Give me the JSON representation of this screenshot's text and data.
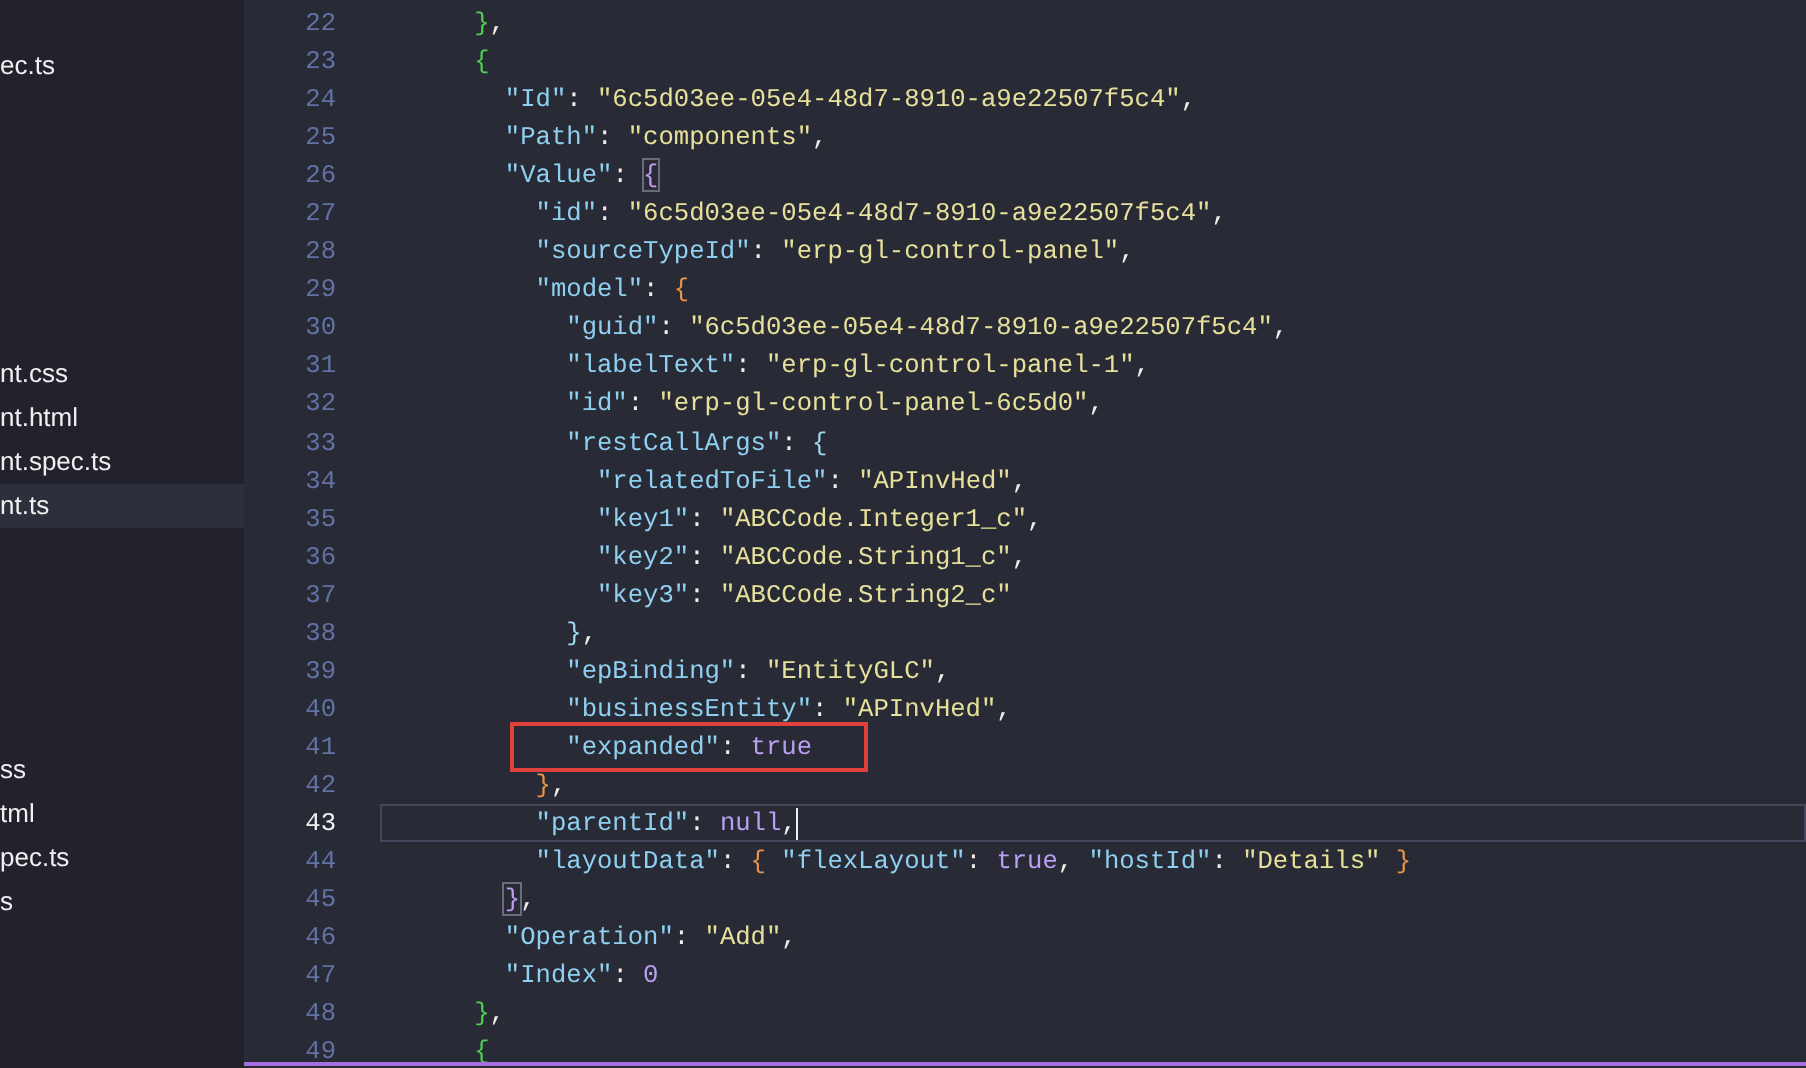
{
  "sidebar": {
    "items": [
      {
        "label": "ec.ts",
        "selected": false
      },
      {
        "label": "nt.css",
        "selected": false
      },
      {
        "label": "nt.html",
        "selected": false
      },
      {
        "label": "nt.spec.ts",
        "selected": false
      },
      {
        "label": "nt.ts",
        "selected": true
      },
      {
        "label": "ss",
        "selected": false
      },
      {
        "label": "tml",
        "selected": false
      },
      {
        "label": "pec.ts",
        "selected": false
      },
      {
        "label": "s",
        "selected": false
      }
    ]
  },
  "editor": {
    "lines": [
      {
        "number": "22",
        "current": false,
        "highlighted": false,
        "tokens": [
          {
            "kind": "brace",
            "text": "}",
            "color": "#50d050",
            "matched": false
          },
          {
            "kind": "punct",
            "text": ","
          }
        ]
      },
      {
        "number": "23",
        "current": false,
        "highlighted": false,
        "tokens": [
          {
            "kind": "brace",
            "text": "{",
            "color": "#50d050",
            "matched": false
          }
        ]
      },
      {
        "number": "24",
        "current": false,
        "highlighted": false,
        "tokens": [
          {
            "kind": "key",
            "text": "\"Id\""
          },
          {
            "kind": "punct",
            "text": ": "
          },
          {
            "kind": "str",
            "text": "\"6c5d03ee-05e4-48d7-8910-a9e22507f5c4\""
          },
          {
            "kind": "punct",
            "text": ","
          }
        ]
      },
      {
        "number": "25",
        "current": false,
        "highlighted": false,
        "tokens": [
          {
            "kind": "key",
            "text": "\"Path\""
          },
          {
            "kind": "punct",
            "text": ": "
          },
          {
            "kind": "str",
            "text": "\"components\""
          },
          {
            "kind": "punct",
            "text": ","
          }
        ]
      },
      {
        "number": "26",
        "current": false,
        "highlighted": false,
        "tokens": [
          {
            "kind": "key",
            "text": "\"Value\""
          },
          {
            "kind": "punct",
            "text": ": "
          },
          {
            "kind": "brace",
            "text": "{",
            "color": "#c39bef",
            "matched": true
          }
        ]
      },
      {
        "number": "27",
        "current": false,
        "highlighted": false,
        "tokens": [
          {
            "kind": "key",
            "text": "\"id\""
          },
          {
            "kind": "punct",
            "text": ": "
          },
          {
            "kind": "str",
            "text": "\"6c5d03ee-05e4-48d7-8910-a9e22507f5c4\""
          },
          {
            "kind": "punct",
            "text": ","
          }
        ]
      },
      {
        "number": "28",
        "current": false,
        "highlighted": false,
        "tokens": [
          {
            "kind": "key",
            "text": "\"sourceTypeId\""
          },
          {
            "kind": "punct",
            "text": ": "
          },
          {
            "kind": "str",
            "text": "\"erp-gl-control-panel\""
          },
          {
            "kind": "punct",
            "text": ","
          }
        ]
      },
      {
        "number": "29",
        "current": false,
        "highlighted": false,
        "tokens": [
          {
            "kind": "key",
            "text": "\"model\""
          },
          {
            "kind": "punct",
            "text": ": "
          },
          {
            "kind": "brace",
            "text": "{",
            "color": "#e8944a",
            "matched": false
          }
        ]
      },
      {
        "number": "30",
        "current": false,
        "highlighted": false,
        "tokens": [
          {
            "kind": "key",
            "text": "\"guid\""
          },
          {
            "kind": "punct",
            "text": ": "
          },
          {
            "kind": "str",
            "text": "\"6c5d03ee-05e4-48d7-8910-a9e22507f5c4\""
          },
          {
            "kind": "punct",
            "text": ","
          }
        ]
      },
      {
        "number": "31",
        "current": false,
        "highlighted": false,
        "tokens": [
          {
            "kind": "key",
            "text": "\"labelText\""
          },
          {
            "kind": "punct",
            "text": ": "
          },
          {
            "kind": "str",
            "text": "\"erp-gl-control-panel-1\""
          },
          {
            "kind": "punct",
            "text": ","
          }
        ]
      },
      {
        "number": "32",
        "current": false,
        "highlighted": false,
        "tokens": [
          {
            "kind": "key",
            "text": "\"id\""
          },
          {
            "kind": "punct",
            "text": ": "
          },
          {
            "kind": "str",
            "text": "\"erp-gl-control-panel-6c5d0\""
          },
          {
            "kind": "punct",
            "text": ","
          }
        ]
      },
      {
        "number": "33",
        "current": false,
        "highlighted": false,
        "tokens": [
          {
            "kind": "key",
            "text": "\"restCallArgs\""
          },
          {
            "kind": "punct",
            "text": ": "
          },
          {
            "kind": "brace",
            "text": "{",
            "color": "#9fd8f0",
            "matched": false
          }
        ]
      },
      {
        "number": "34",
        "current": false,
        "highlighted": false,
        "tokens": [
          {
            "kind": "key",
            "text": "\"relatedToFile\""
          },
          {
            "kind": "punct",
            "text": ": "
          },
          {
            "kind": "str",
            "text": "\"APInvHed\""
          },
          {
            "kind": "punct",
            "text": ","
          }
        ]
      },
      {
        "number": "35",
        "current": false,
        "highlighted": false,
        "tokens": [
          {
            "kind": "key",
            "text": "\"key1\""
          },
          {
            "kind": "punct",
            "text": ": "
          },
          {
            "kind": "str",
            "text": "\"ABCCode.Integer1_c\""
          },
          {
            "kind": "punct",
            "text": ","
          }
        ]
      },
      {
        "number": "36",
        "current": false,
        "highlighted": false,
        "tokens": [
          {
            "kind": "key",
            "text": "\"key2\""
          },
          {
            "kind": "punct",
            "text": ": "
          },
          {
            "kind": "str",
            "text": "\"ABCCode.String1_c\""
          },
          {
            "kind": "punct",
            "text": ","
          }
        ]
      },
      {
        "number": "37",
        "current": false,
        "highlighted": false,
        "tokens": [
          {
            "kind": "key",
            "text": "\"key3\""
          },
          {
            "kind": "punct",
            "text": ": "
          },
          {
            "kind": "str",
            "text": "\"ABCCode.String2_c\""
          }
        ]
      },
      {
        "number": "38",
        "current": false,
        "highlighted": false,
        "tokens": [
          {
            "kind": "brace",
            "text": "}",
            "color": "#9fd8f0",
            "matched": false
          },
          {
            "kind": "punct",
            "text": ","
          }
        ]
      },
      {
        "number": "39",
        "current": false,
        "highlighted": false,
        "tokens": [
          {
            "kind": "key",
            "text": "\"epBinding\""
          },
          {
            "kind": "punct",
            "text": ": "
          },
          {
            "kind": "str",
            "text": "\"EntityGLC\""
          },
          {
            "kind": "punct",
            "text": ","
          }
        ]
      },
      {
        "number": "40",
        "current": false,
        "highlighted": false,
        "tokens": [
          {
            "kind": "key",
            "text": "\"businessEntity\""
          },
          {
            "kind": "punct",
            "text": ": "
          },
          {
            "kind": "str",
            "text": "\"APInvHed\""
          },
          {
            "kind": "punct",
            "text": ","
          }
        ]
      },
      {
        "number": "41",
        "current": false,
        "highlighted": true,
        "tokens": [
          {
            "kind": "key",
            "text": "\"expanded\""
          },
          {
            "kind": "punct",
            "text": ": "
          },
          {
            "kind": "kw",
            "text": "true"
          }
        ]
      },
      {
        "number": "42",
        "current": false,
        "highlighted": false,
        "tokens": [
          {
            "kind": "brace",
            "text": "}",
            "color": "#e8944a",
            "matched": false
          },
          {
            "kind": "punct",
            "text": ","
          }
        ]
      },
      {
        "number": "43",
        "current": true,
        "highlighted": false,
        "tokens": [
          {
            "kind": "key",
            "text": "\"parentId\""
          },
          {
            "kind": "punct",
            "text": ": "
          },
          {
            "kind": "kw",
            "text": "null"
          },
          {
            "kind": "punct",
            "text": ","
          }
        ]
      },
      {
        "number": "44",
        "current": false,
        "highlighted": false,
        "tokens": [
          {
            "kind": "key",
            "text": "\"layoutData\""
          },
          {
            "kind": "punct",
            "text": ": "
          },
          {
            "kind": "brace",
            "text": "{",
            "color": "#e8944a",
            "matched": false
          },
          {
            "kind": "key",
            "text": " \"flexLayout\""
          },
          {
            "kind": "punct",
            "text": ": "
          },
          {
            "kind": "kw",
            "text": "true"
          },
          {
            "kind": "punct",
            "text": ", "
          },
          {
            "kind": "key",
            "text": "\"hostId\""
          },
          {
            "kind": "punct",
            "text": ": "
          },
          {
            "kind": "str",
            "text": "\"Details\" "
          },
          {
            "kind": "brace",
            "text": "}",
            "color": "#e8944a",
            "matched": false
          }
        ]
      },
      {
        "number": "45",
        "current": false,
        "highlighted": false,
        "tokens": [
          {
            "kind": "brace",
            "text": "}",
            "color": "#c39bef",
            "matched": true
          },
          {
            "kind": "punct",
            "text": ","
          }
        ]
      },
      {
        "number": "46",
        "current": false,
        "highlighted": false,
        "tokens": [
          {
            "kind": "key",
            "text": "\"Operation\""
          },
          {
            "kind": "punct",
            "text": ": "
          },
          {
            "kind": "str",
            "text": "\"Add\""
          },
          {
            "kind": "punct",
            "text": ","
          }
        ]
      },
      {
        "number": "47",
        "current": false,
        "highlighted": false,
        "tokens": [
          {
            "kind": "key",
            "text": "\"Index\""
          },
          {
            "kind": "punct",
            "text": ": "
          },
          {
            "kind": "kw",
            "text": "0"
          }
        ]
      },
      {
        "number": "48",
        "current": false,
        "highlighted": false,
        "tokens": [
          {
            "kind": "brace",
            "text": "}",
            "color": "#50d050",
            "matched": false
          },
          {
            "kind": "punct",
            "text": ","
          }
        ]
      },
      {
        "number": "49",
        "current": false,
        "highlighted": false,
        "tokens": [
          {
            "kind": "brace",
            "text": "{",
            "color": "#50d050",
            "matched": false
          }
        ]
      }
    ]
  }
}
